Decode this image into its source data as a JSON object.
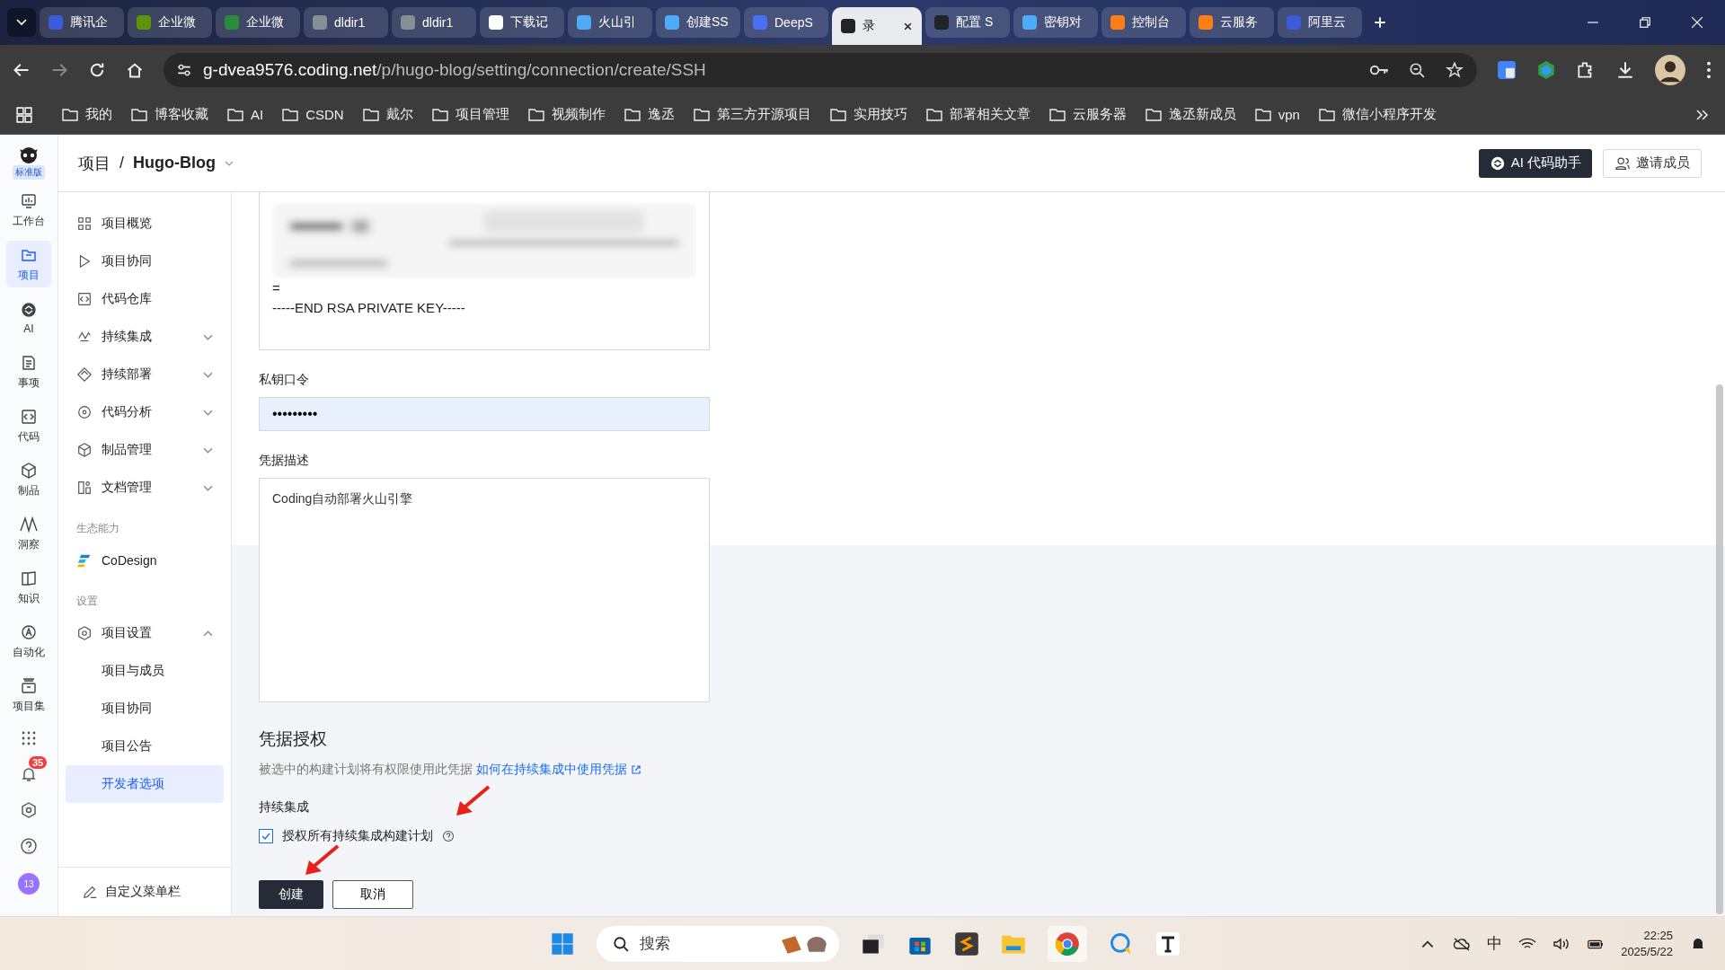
{
  "browser": {
    "tabs": [
      {
        "title": "腾讯企",
        "color": "#3b5bdb",
        "selected": false
      },
      {
        "title": "企业微",
        "color": "#5c940d",
        "selected": false
      },
      {
        "title": "企业微",
        "color": "#2b8a3e",
        "selected": false
      },
      {
        "title": "dldir1",
        "color": "#868e96",
        "selected": false
      },
      {
        "title": "dldir1",
        "color": "#868e96",
        "selected": false
      },
      {
        "title": "下载记",
        "color": "#ffffff",
        "selected": false
      },
      {
        "title": "火山引",
        "color": "#4dabf7",
        "selected": false
      },
      {
        "title": "创建SS",
        "color": "#4dabf7",
        "selected": false
      },
      {
        "title": "DeepS",
        "color": "#4c6ef5",
        "selected": false
      },
      {
        "title": "录",
        "color": "#212529",
        "selected": true
      },
      {
        "title": "配置 S",
        "color": "#212529",
        "selected": false
      },
      {
        "title": "密钥对",
        "color": "#4dabf7",
        "selected": false
      },
      {
        "title": "控制台",
        "color": "#fd7e14",
        "selected": false
      },
      {
        "title": "云服务",
        "color": "#fd7e14",
        "selected": false
      },
      {
        "title": "阿里云",
        "color": "#3b5bdb",
        "selected": false
      }
    ],
    "address": {
      "host": "g-dvea9576.coding.net",
      "path": "/p/hugo-blog/setting/connection/create/SSH"
    },
    "bookmarks": [
      "我的",
      "博客收藏",
      "AI",
      "CSDN",
      "戴尔",
      "项目管理",
      "视频制作",
      "逸丞",
      "第三方开源项目",
      "实用技巧",
      "部署相关文章",
      "云服务器",
      "逸丞新成员",
      "vpn",
      "微信小程序开发"
    ]
  },
  "rail": {
    "edition": "标准版",
    "items": [
      {
        "label": "工作台",
        "selected": false
      },
      {
        "label": "项目",
        "selected": true
      },
      {
        "label": "AI",
        "selected": false
      },
      {
        "label": "事项",
        "selected": false
      },
      {
        "label": "代码",
        "selected": false
      },
      {
        "label": "制品",
        "selected": false
      },
      {
        "label": "洞察",
        "selected": false
      },
      {
        "label": "知识",
        "selected": false
      },
      {
        "label": "自动化",
        "selected": false
      },
      {
        "label": "项目集",
        "selected": false
      }
    ],
    "notification_count": "35",
    "avatar": "13"
  },
  "header": {
    "breadcrumb": [
      "项目",
      "/",
      "Hugo-Blog"
    ],
    "buttons": [
      "AI 代码助手",
      "邀请成员"
    ]
  },
  "sidebar": {
    "items": [
      {
        "label": "项目概览",
        "expandable": false
      },
      {
        "label": "项目协同",
        "expandable": false
      },
      {
        "label": "代码仓库",
        "expandable": false
      },
      {
        "label": "持续集成",
        "expandable": true
      },
      {
        "label": "持续部署",
        "expandable": true
      },
      {
        "label": "代码分析",
        "expandable": true
      },
      {
        "label": "制品管理",
        "expandable": true
      },
      {
        "label": "文档管理",
        "expandable": true
      }
    ],
    "eco_section": "生态能力",
    "eco_item": "CoDesign",
    "settings_section": "设置",
    "settings": {
      "label": "项目设置",
      "expanded": true,
      "children": [
        {
          "label": "项目与成员",
          "selected": false
        },
        {
          "label": "项目协同",
          "selected": false
        },
        {
          "label": "项目公告",
          "selected": false
        },
        {
          "label": "开发者选项",
          "selected": true
        }
      ]
    },
    "footer": "自定义菜单栏"
  },
  "form": {
    "private_key": {
      "lines": [
        "=",
        "-----END RSA PRIVATE KEY-----"
      ]
    },
    "passphrase": {
      "label": "私钥口令",
      "value": "•••••••••"
    },
    "description": {
      "label": "凭据描述",
      "value": "Coding自动部署火山引擎"
    },
    "authorization": {
      "title": "凭据授权",
      "text": "被选中的构建计划将有权限使用此凭据",
      "link": "如何在持续集成中使用凭据",
      "group": "持续集成",
      "checkbox": {
        "label": "授权所有持续集成构建计划",
        "checked": true
      }
    },
    "buttons": [
      "创建",
      "取消"
    ]
  },
  "taskbar": {
    "search": "搜索",
    "ime": "中",
    "time": "22:25",
    "date": "2025/5/22"
  }
}
